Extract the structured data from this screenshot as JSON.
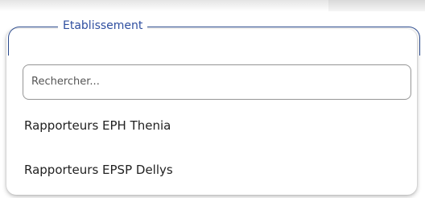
{
  "dropdown": {
    "legend": "Etablissement",
    "search": {
      "placeholder": "Rechercher...",
      "value": ""
    },
    "options": [
      {
        "label": "Rapporteurs EPH Thenia"
      },
      {
        "label": "Rapporteurs EPSP Dellys"
      }
    ]
  },
  "colors": {
    "accent": "#2b4a8c",
    "legend_text": "#2f4fa0",
    "input_border": "#9a9a9a",
    "option_text": "#222222"
  }
}
